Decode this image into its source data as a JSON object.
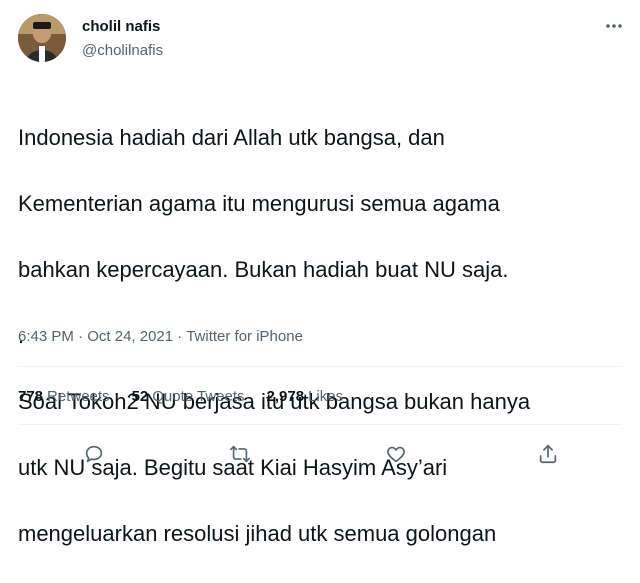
{
  "author": {
    "name": "cholil nafis",
    "handle": "@cholilnafis",
    "avatar_icon": "profile-photo"
  },
  "tweet": {
    "lines": [
      "Indonesia hadiah dari Allah utk bangsa, dan",
      "Kementerian agama itu mengurusi semua agama",
      "bahkan kepercayaan. Bukan hadiah buat NU saja.",
      ".",
      "Soal Tokoh2 NU berjasa itu utk bangsa bukan hanya",
      "utk NU saja. Begitu saat Kiai Hasyim Asy’ari",
      "mengeluarkan resolusi jihad utk semua golongan"
    ]
  },
  "meta": {
    "time": "6:43 PM",
    "sep1": " · ",
    "date": "Oct 24, 2021",
    "sep2": " · ",
    "source": "Twitter for iPhone"
  },
  "stats": {
    "retweets_count": "778",
    "retweets_label": "Retweets",
    "quotes_count": "52",
    "quotes_label": "Quote Tweets",
    "likes_count": "2,978",
    "likes_label": "Likes"
  },
  "actions": [
    "reply-icon",
    "retweet-icon",
    "like-icon",
    "share-icon"
  ],
  "colors": {
    "text": "#0f1419",
    "secondary": "#536471",
    "divider": "#eff3f4"
  }
}
